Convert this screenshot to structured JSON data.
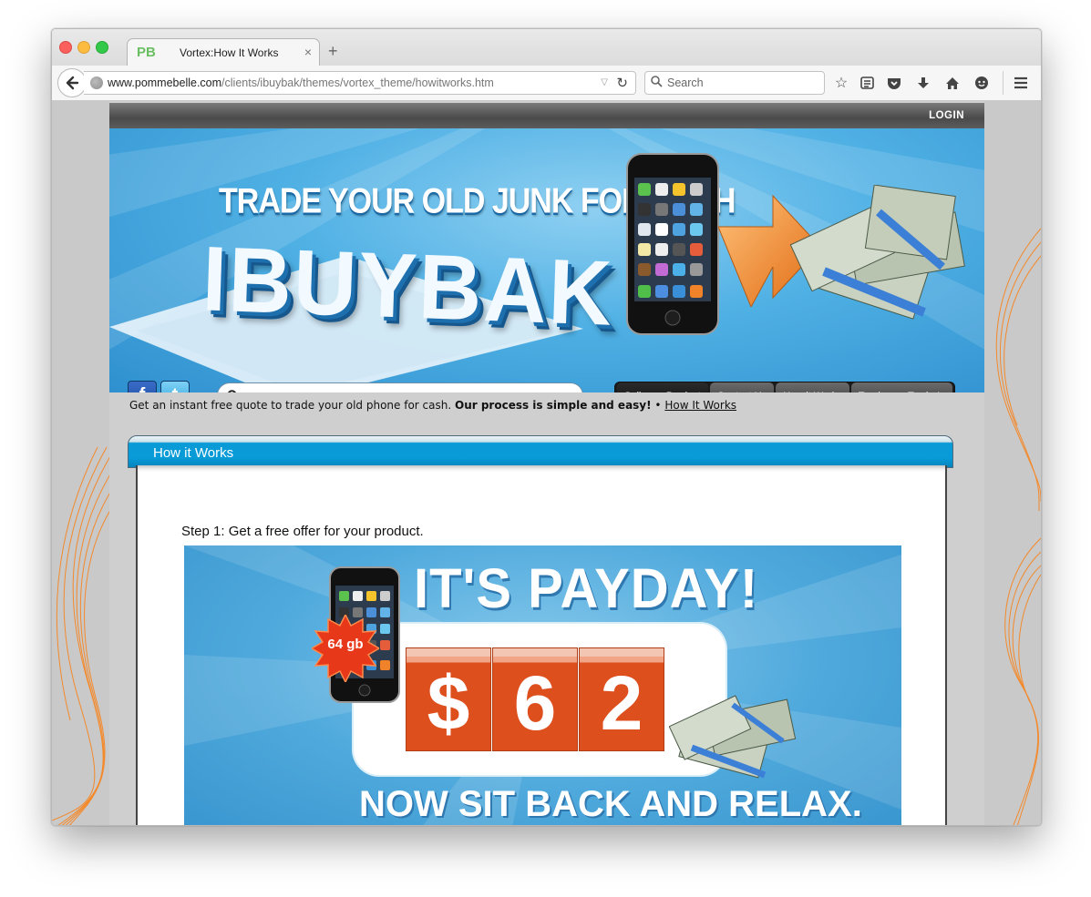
{
  "browser": {
    "tab_title": "Vortex:How It Works",
    "tab_favicon": "PB",
    "url_domain": "www.pommebelle.com",
    "url_path": "/clients/ibuybak/themes/vortex_theme/howitworks.htm",
    "search_placeholder": "Search",
    "toolbar_icons": [
      "bookmark-star-icon",
      "reading-list-icon",
      "pocket-icon",
      "download-icon",
      "home-icon",
      "chat-icon",
      "menu-icon"
    ]
  },
  "site": {
    "login_label": "LOGIN",
    "banner": {
      "slogan": "TRADE YOUR OLD JUNK FOR CASH",
      "brand": "IBUYBAK"
    },
    "social": [
      "facebook-icon",
      "twitter-icon"
    ],
    "nav": [
      {
        "label": "Sell your Product",
        "active": true
      },
      {
        "label": "Contact Us",
        "active": false
      },
      {
        "label": "How it Works",
        "active": false
      },
      {
        "label": "Track your Trade-In",
        "active": false
      }
    ],
    "intro": {
      "text": "Get an instant free quote to trade your old phone for cash.",
      "bold": "Our process is simple and easy!",
      "sep": " • ",
      "link": "How It Works"
    },
    "panel": {
      "title": "How it Works",
      "step1": "Step 1: Get a free offer for your product.",
      "graphic": {
        "headline": "IT'S PAYDAY!",
        "badge": "64 gb",
        "digits": [
          "$",
          "6",
          "2"
        ],
        "footer": "NOW SIT BACK AND RELAX."
      }
    }
  },
  "colors": {
    "banner_blue": "#4fb0e4",
    "panel_header": "#079bd8",
    "digit_orange": "#de4f1e",
    "swirl_orange": "#f4892a"
  }
}
